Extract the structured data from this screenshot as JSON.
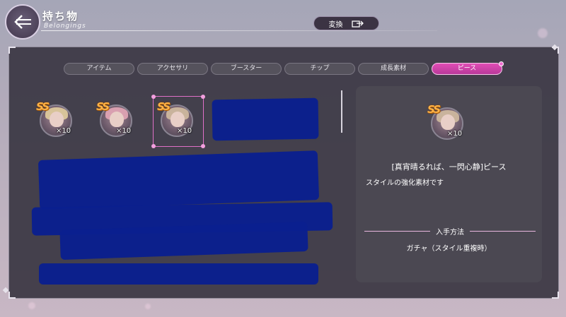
{
  "header": {
    "title": "持ち物",
    "subtitle": "Belongings",
    "convert_label": "変換"
  },
  "tabs": [
    {
      "label": "アイテム",
      "active": false
    },
    {
      "label": "アクセサリ",
      "active": false
    },
    {
      "label": "ブースター",
      "active": false
    },
    {
      "label": "チップ",
      "active": false
    },
    {
      "label": "成長素材",
      "active": false
    },
    {
      "label": "ピース",
      "active": true
    }
  ],
  "items": [
    {
      "rank": "SS",
      "qty": "×10",
      "hair": "#d8c39a"
    },
    {
      "rank": "SS",
      "qty": "×10",
      "hair": "#d9a0b0"
    },
    {
      "rank": "SS",
      "qty": "×10",
      "hair": "#c9b39c"
    }
  ],
  "detail": {
    "rank": "SS",
    "qty": "×10",
    "name": "[真宵晴るれば、一閃心静]ピース",
    "description": "スタイルの強化素材です",
    "acquire_title": "入手方法",
    "acquire_value": "ガチャ（スタイル重複時）"
  },
  "colors": {
    "accent": "#d948b0",
    "rank_gold": "#ffb347",
    "redaction": "#0a1f8f"
  }
}
